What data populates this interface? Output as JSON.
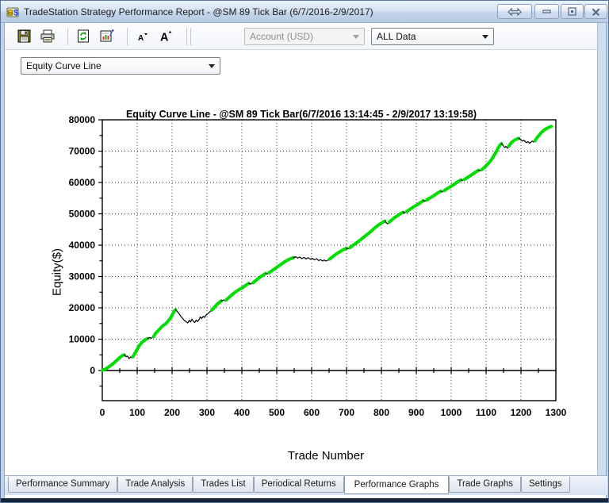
{
  "window": {
    "title": "TradeStation Strategy Performance Report - @SM 89 Tick Bar (6/7/2016-2/9/2017)",
    "icons": {
      "app-icon": "coins-report",
      "link-windows-icon": "double-horizontal-arrow",
      "minimize-icon": "horizontal-bar",
      "restore-icon": "overlapping-window",
      "close-icon": "x-cross"
    }
  },
  "toolbar": {
    "icons": [
      "save-icon",
      "print-icon",
      "refresh-icon",
      "report-settings-icon",
      "font-decrease-icon",
      "font-increase-icon"
    ],
    "account_combo": {
      "value": "Account (USD)",
      "disabled": true
    },
    "range_combo": {
      "value": "ALL Data",
      "disabled": false
    }
  },
  "graph_selector": {
    "value": "Equity Curve Line"
  },
  "chart_data": {
    "type": "line",
    "title": "Equity Curve Line - @SM 89 Tick Bar(6/7/2016 13:14:45 - 2/9/2017 13:19:58)",
    "xlabel": "Trade Number",
    "ylabel": "Equity($)",
    "xlim": [
      0,
      1300
    ],
    "ylim": [
      -9600,
      80000
    ],
    "x_ticks": [
      0,
      100,
      200,
      300,
      400,
      500,
      600,
      700,
      800,
      900,
      1000,
      1100,
      1200,
      1300
    ],
    "y_ticks": [
      0,
      10000,
      20000,
      30000,
      40000,
      50000,
      60000,
      70000,
      80000
    ],
    "x_minor_step": 50,
    "y_minor_step": 5000,
    "grid": "dotted",
    "legend_position": "none",
    "colors": {
      "equity_up": "#00dd00",
      "drawdown": "#000000",
      "grid": "#444444",
      "axis": "#000000"
    },
    "segments": [
      {
        "c": "g",
        "pts": [
          [
            0,
            0
          ],
          [
            8,
            400
          ],
          [
            18,
            1100
          ],
          [
            30,
            2100
          ],
          [
            42,
            3300
          ],
          [
            52,
            4300
          ],
          [
            58,
            4800
          ],
          [
            63,
            5000
          ]
        ]
      },
      {
        "c": "b",
        "pts": [
          [
            63,
            5000
          ],
          [
            68,
            4400
          ],
          [
            72,
            4600
          ],
          [
            77,
            3800
          ],
          [
            81,
            4300
          ],
          [
            85,
            4100
          ],
          [
            88,
            4400
          ]
        ]
      },
      {
        "c": "g",
        "pts": [
          [
            88,
            4400
          ],
          [
            95,
            5800
          ],
          [
            101,
            6900
          ],
          [
            107,
            8100
          ],
          [
            113,
            8900
          ],
          [
            118,
            9400
          ],
          [
            124,
            9900
          ],
          [
            130,
            10200
          ]
        ]
      },
      {
        "c": "b",
        "pts": [
          [
            130,
            10200
          ],
          [
            136,
            10500
          ],
          [
            141,
            10300
          ],
          [
            147,
            10800
          ]
        ]
      },
      {
        "c": "g",
        "pts": [
          [
            147,
            10800
          ],
          [
            153,
            11900
          ],
          [
            159,
            12600
          ],
          [
            165,
            13300
          ],
          [
            171,
            14000
          ],
          [
            176,
            14500
          ],
          [
            182,
            14900
          ],
          [
            188,
            15700
          ],
          [
            194,
            16500
          ],
          [
            200,
            17600
          ],
          [
            205,
            18700
          ],
          [
            210,
            19400
          ]
        ]
      },
      {
        "c": "b",
        "pts": [
          [
            210,
            19400
          ],
          [
            216,
            18700
          ],
          [
            221,
            18000
          ],
          [
            226,
            17200
          ],
          [
            231,
            16500
          ],
          [
            236,
            15900
          ],
          [
            241,
            15500
          ],
          [
            245,
            15200
          ],
          [
            249,
            16000
          ],
          [
            253,
            15500
          ],
          [
            257,
            16400
          ],
          [
            261,
            15700
          ],
          [
            265,
            15300
          ],
          [
            269,
            16100
          ],
          [
            273,
            15600
          ],
          [
            277,
            16200
          ],
          [
            281,
            17100
          ],
          [
            285,
            16600
          ],
          [
            289,
            17300
          ],
          [
            293,
            16900
          ],
          [
            297,
            17700
          ],
          [
            302,
            18100
          ],
          [
            306,
            18500
          ],
          [
            310,
            18900
          ],
          [
            314,
            19300
          ]
        ]
      },
      {
        "c": "g",
        "pts": [
          [
            314,
            19300
          ],
          [
            320,
            20000
          ],
          [
            327,
            20900
          ],
          [
            334,
            21600
          ],
          [
            341,
            22200
          ]
        ]
      },
      {
        "c": "b",
        "pts": [
          [
            341,
            22200
          ],
          [
            348,
            22500
          ],
          [
            354,
            22400
          ]
        ]
      },
      {
        "c": "g",
        "pts": [
          [
            354,
            22400
          ],
          [
            362,
            23200
          ],
          [
            371,
            24100
          ],
          [
            380,
            24900
          ],
          [
            390,
            25700
          ],
          [
            400,
            26300
          ],
          [
            410,
            27100
          ],
          [
            420,
            27800
          ]
        ]
      },
      {
        "c": "b",
        "pts": [
          [
            420,
            27800
          ],
          [
            426,
            27600
          ],
          [
            432,
            28000
          ]
        ]
      },
      {
        "c": "g",
        "pts": [
          [
            432,
            28000
          ],
          [
            441,
            28800
          ],
          [
            450,
            29600
          ],
          [
            459,
            30300
          ],
          [
            468,
            31000
          ]
        ]
      },
      {
        "c": "b",
        "pts": [
          [
            468,
            31000
          ],
          [
            473,
            30800
          ],
          [
            478,
            31200
          ]
        ]
      },
      {
        "c": "g",
        "pts": [
          [
            478,
            31200
          ],
          [
            487,
            31900
          ],
          [
            496,
            32600
          ],
          [
            505,
            33300
          ],
          [
            514,
            34000
          ],
          [
            523,
            34700
          ],
          [
            532,
            35300
          ],
          [
            540,
            35700
          ],
          [
            548,
            36000
          ]
        ]
      },
      {
        "c": "b",
        "pts": [
          [
            548,
            36000
          ],
          [
            554,
            36300
          ],
          [
            560,
            35900
          ],
          [
            566,
            36200
          ],
          [
            572,
            35700
          ],
          [
            578,
            36100
          ],
          [
            584,
            35600
          ],
          [
            590,
            36000
          ],
          [
            596,
            35500
          ],
          [
            602,
            35800
          ],
          [
            608,
            35300
          ],
          [
            614,
            35700
          ],
          [
            620,
            35100
          ],
          [
            626,
            35400
          ],
          [
            631,
            34900
          ],
          [
            636,
            35300
          ],
          [
            641,
            34900
          ],
          [
            646,
            35200
          ],
          [
            651,
            35500
          ]
        ]
      },
      {
        "c": "g",
        "pts": [
          [
            651,
            35500
          ],
          [
            659,
            36200
          ],
          [
            667,
            36900
          ],
          [
            675,
            37500
          ],
          [
            684,
            38100
          ],
          [
            692,
            38600
          ],
          [
            700,
            39000
          ]
        ]
      },
      {
        "c": "b",
        "pts": [
          [
            700,
            39000
          ],
          [
            705,
            38800
          ],
          [
            710,
            39200
          ]
        ]
      },
      {
        "c": "g",
        "pts": [
          [
            710,
            39200
          ],
          [
            718,
            39900
          ],
          [
            726,
            40500
          ],
          [
            734,
            41200
          ],
          [
            742,
            41900
          ],
          [
            750,
            42600
          ],
          [
            758,
            43300
          ],
          [
            766,
            44000
          ],
          [
            774,
            44800
          ],
          [
            782,
            45600
          ],
          [
            790,
            46300
          ],
          [
            798,
            46900
          ],
          [
            805,
            47400
          ],
          [
            810,
            47700
          ]
        ]
      },
      {
        "c": "b",
        "pts": [
          [
            810,
            47700
          ],
          [
            814,
            47100
          ],
          [
            818,
            46800
          ],
          [
            822,
            47300
          ]
        ]
      },
      {
        "c": "g",
        "pts": [
          [
            822,
            47300
          ],
          [
            830,
            48100
          ],
          [
            838,
            48800
          ],
          [
            846,
            49400
          ],
          [
            854,
            50000
          ],
          [
            862,
            50500
          ]
        ]
      },
      {
        "c": "b",
        "pts": [
          [
            862,
            50500
          ],
          [
            867,
            50300
          ],
          [
            872,
            50700
          ]
        ]
      },
      {
        "c": "g",
        "pts": [
          [
            872,
            50700
          ],
          [
            880,
            51300
          ],
          [
            888,
            51900
          ],
          [
            896,
            52500
          ],
          [
            904,
            53000
          ],
          [
            912,
            53600
          ],
          [
            920,
            54200
          ]
        ]
      },
      {
        "c": "b",
        "pts": [
          [
            920,
            54200
          ],
          [
            925,
            54000
          ],
          [
            930,
            54400
          ]
        ]
      },
      {
        "c": "g",
        "pts": [
          [
            930,
            54400
          ],
          [
            938,
            55000
          ],
          [
            946,
            55500
          ],
          [
            954,
            56100
          ],
          [
            962,
            56700
          ],
          [
            970,
            57200
          ]
        ]
      },
      {
        "c": "b",
        "pts": [
          [
            970,
            57200
          ],
          [
            975,
            57000
          ],
          [
            980,
            57400
          ]
        ]
      },
      {
        "c": "g",
        "pts": [
          [
            980,
            57400
          ],
          [
            988,
            58000
          ],
          [
            996,
            58500
          ],
          [
            1004,
            59100
          ],
          [
            1012,
            59700
          ],
          [
            1020,
            60300
          ],
          [
            1028,
            60800
          ]
        ]
      },
      {
        "c": "b",
        "pts": [
          [
            1028,
            60800
          ],
          [
            1033,
            60600
          ],
          [
            1038,
            61000
          ]
        ]
      },
      {
        "c": "g",
        "pts": [
          [
            1038,
            61000
          ],
          [
            1046,
            61500
          ],
          [
            1054,
            62100
          ],
          [
            1062,
            62700
          ],
          [
            1070,
            63300
          ],
          [
            1078,
            63900
          ]
        ]
      },
      {
        "c": "b",
        "pts": [
          [
            1078,
            63900
          ],
          [
            1083,
            63700
          ],
          [
            1088,
            64100
          ]
        ]
      },
      {
        "c": "g",
        "pts": [
          [
            1088,
            64100
          ],
          [
            1095,
            64800
          ],
          [
            1102,
            65600
          ],
          [
            1109,
            66400
          ],
          [
            1116,
            67400
          ],
          [
            1123,
            68600
          ],
          [
            1129,
            69800
          ],
          [
            1134,
            70900
          ],
          [
            1139,
            71800
          ],
          [
            1144,
            72400
          ]
        ]
      },
      {
        "c": "b",
        "pts": [
          [
            1144,
            72400
          ],
          [
            1149,
            71800
          ],
          [
            1153,
            71200
          ],
          [
            1157,
            71500
          ],
          [
            1161,
            70900
          ],
          [
            1165,
            71600
          ]
        ]
      },
      {
        "c": "g",
        "pts": [
          [
            1165,
            71600
          ],
          [
            1171,
            72500
          ],
          [
            1177,
            73200
          ],
          [
            1183,
            73600
          ],
          [
            1189,
            73900
          ],
          [
            1194,
            74100
          ]
        ]
      },
      {
        "c": "b",
        "pts": [
          [
            1194,
            74100
          ],
          [
            1199,
            73600
          ],
          [
            1204,
            73200
          ],
          [
            1208,
            73500
          ],
          [
            1212,
            73000
          ],
          [
            1216,
            72700
          ],
          [
            1220,
            73100
          ],
          [
            1224,
            72500
          ],
          [
            1228,
            72800
          ],
          [
            1232,
            73200
          ],
          [
            1236,
            72900
          ],
          [
            1240,
            73300
          ]
        ]
      },
      {
        "c": "g",
        "pts": [
          [
            1240,
            73300
          ],
          [
            1246,
            74300
          ],
          [
            1252,
            75100
          ],
          [
            1258,
            75900
          ],
          [
            1264,
            76500
          ],
          [
            1270,
            77000
          ],
          [
            1276,
            77400
          ],
          [
            1282,
            77700
          ],
          [
            1287,
            77900
          ]
        ]
      }
    ]
  },
  "tabs": {
    "active": "Performance Graphs",
    "items": [
      {
        "label": "Performance Summary"
      },
      {
        "label": "Trade Analysis"
      },
      {
        "label": "Trades List"
      },
      {
        "label": "Periodical Returns"
      },
      {
        "label": "Performance Graphs"
      },
      {
        "label": "Trade Graphs"
      },
      {
        "label": "Settings"
      }
    ]
  }
}
